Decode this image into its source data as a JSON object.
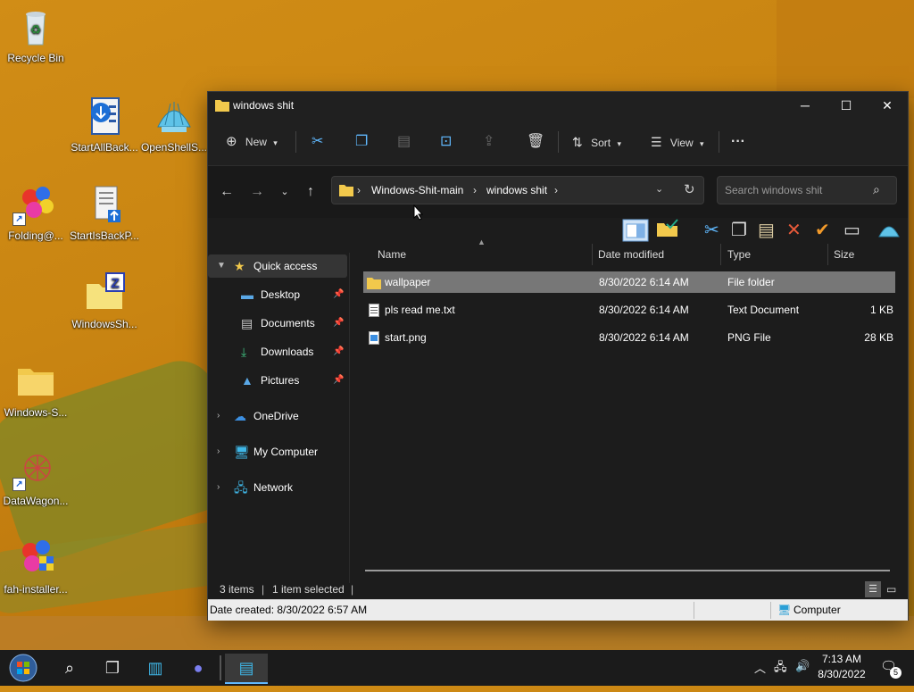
{
  "desktop": {
    "icons": [
      {
        "label": "Recycle Bin"
      },
      {
        "label": "StartAllBack..."
      },
      {
        "label": "OpenShellS..."
      },
      {
        "label": "Folding@..."
      },
      {
        "label": "StartIsBackP..."
      },
      {
        "label": "WindowsSh..."
      },
      {
        "label": "Windows-S..."
      },
      {
        "label": "DataWagon..."
      },
      {
        "label": "fah-installer..."
      }
    ]
  },
  "window": {
    "title": "windows shit",
    "toolbar": {
      "new_label": "New",
      "sort_label": "Sort",
      "view_label": "View",
      "more_label": "···"
    },
    "address": {
      "segments": [
        "Windows-Shit-main",
        "windows shit"
      ]
    },
    "search": {
      "placeholder": "Search windows shit"
    },
    "nav": {
      "quick_access": "Quick access",
      "desktop": "Desktop",
      "documents": "Documents",
      "downloads": "Downloads",
      "pictures": "Pictures",
      "onedrive": "OneDrive",
      "my_computer": "My Computer",
      "network": "Network"
    },
    "columns": {
      "name": "Name",
      "date": "Date modified",
      "type": "Type",
      "size": "Size"
    },
    "files": [
      {
        "name": "wallpaper",
        "date": "8/30/2022 6:14 AM",
        "type": "File folder",
        "size": ""
      },
      {
        "name": "pls read me.txt",
        "date": "8/30/2022 6:14 AM",
        "type": "Text Document",
        "size": "1 KB"
      },
      {
        "name": "start.png",
        "date": "8/30/2022 6:14 AM",
        "type": "PNG File",
        "size": "28 KB"
      }
    ],
    "status": {
      "items": "3 items",
      "selected": "1 item selected"
    },
    "info": {
      "date_created": "Date created: 8/30/2022 6:57 AM",
      "location": "Computer"
    }
  },
  "taskbar": {
    "time": "7:13 AM",
    "date": "8/30/2022",
    "notifications": "5"
  },
  "colors": {
    "accent": "#60b9ff",
    "folder": "#f2c94c",
    "window_bg": "#1c1c1c",
    "selection": "#777777"
  }
}
